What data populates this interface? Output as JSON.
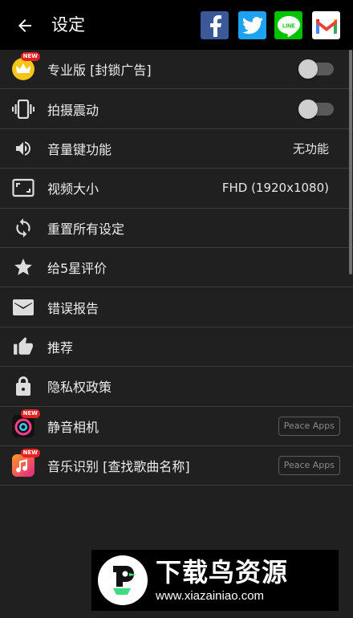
{
  "header": {
    "title": "设定",
    "share": [
      {
        "name": "facebook",
        "color": "#3b5998"
      },
      {
        "name": "twitter",
        "color": "#1da1f2"
      },
      {
        "name": "line",
        "label": "LINE",
        "color": "#00c300"
      },
      {
        "name": "gmail",
        "color": "#ea4335"
      }
    ]
  },
  "settings": {
    "pro": {
      "label": "专业版 [封锁广告]",
      "badge": "NEW",
      "toggle_on": false
    },
    "vibrate": {
      "label": "拍摄震动",
      "toggle_on": false
    },
    "volume_key": {
      "label": "音量键功能",
      "value": "无功能"
    },
    "video_size": {
      "label": "视频大小",
      "value": "FHD (1920x1080)"
    },
    "reset": {
      "label": "重置所有设定"
    },
    "rate": {
      "label": "给5星评价"
    },
    "report": {
      "label": "错误报告"
    },
    "recommend": {
      "label": "推荐"
    },
    "privacy": {
      "label": "隐私权政策"
    },
    "silent_camera": {
      "label": "静音相机",
      "badge": "NEW",
      "button": "Peace Apps"
    },
    "music_id": {
      "label": "音乐识别 [查找歌曲名称]",
      "badge": "NEW",
      "button": "Peace Apps"
    }
  },
  "watermark": {
    "title": "下载鸟资源",
    "url": "www.xiazainiao.com"
  }
}
